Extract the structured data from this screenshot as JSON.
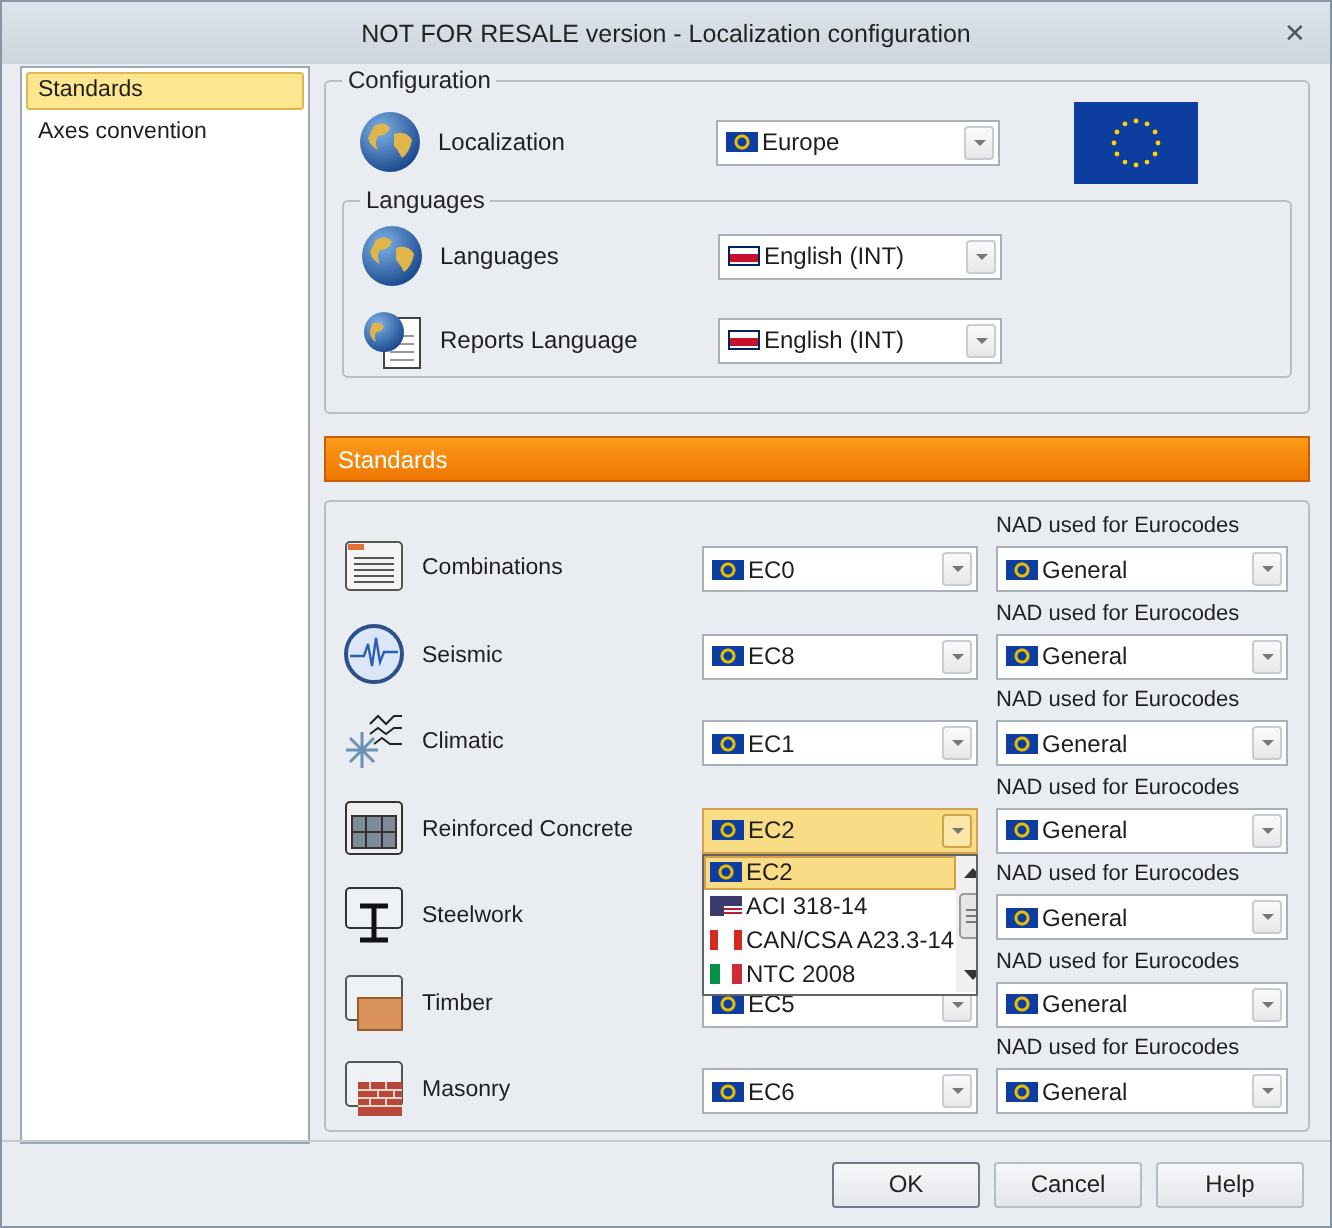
{
  "window": {
    "title": "NOT FOR RESALE version - Localization configuration",
    "close": "✕"
  },
  "sidebar": {
    "items": [
      {
        "label": "Standards",
        "selected": true
      },
      {
        "label": "Axes convention",
        "selected": false
      }
    ]
  },
  "configuration": {
    "title": "Configuration",
    "localization": {
      "label": "Localization",
      "value": "Europe"
    },
    "languages_group": {
      "title": "Languages",
      "rows": [
        {
          "label": "Languages",
          "value": "English (INT)"
        },
        {
          "label": "Reports Language",
          "value": "English (INT)"
        }
      ]
    }
  },
  "standards": {
    "header": "Standards",
    "rows": [
      {
        "name": "Combinations",
        "value": "EC0",
        "focused": false,
        "nad_label": "NAD used for Eurocodes",
        "nad_value": "General"
      },
      {
        "name": "Seismic",
        "value": "EC8",
        "focused": false,
        "nad_label": "NAD used for Eurocodes",
        "nad_value": "General"
      },
      {
        "name": "Climatic",
        "value": "EC1",
        "focused": false,
        "nad_label": "NAD used for Eurocodes",
        "nad_value": "General"
      },
      {
        "name": "Reinforced Concrete",
        "value": "EC2",
        "focused": true,
        "nad_label": "NAD used for Eurocodes",
        "nad_value": "General",
        "options": [
          {
            "label": "EC2",
            "selected": true
          },
          {
            "label": "ACI 318-14",
            "selected": false
          },
          {
            "label": "CAN/CSA A23.3-14",
            "selected": false
          },
          {
            "label": "NTC 2008",
            "selected": false
          }
        ]
      },
      {
        "name": "Steelwork",
        "nad_label": "NAD used for Eurocodes",
        "nad_value": "General"
      },
      {
        "name": "Timber",
        "value": "EC5",
        "focused": false,
        "nad_label": "NAD used for Eurocodes",
        "nad_value": "General"
      },
      {
        "name": "Masonry",
        "value": "EC6",
        "focused": false,
        "nad_label": "NAD used for Eurocodes",
        "nad_value": "General"
      }
    ]
  },
  "buttons": [
    {
      "label": "OK",
      "default": true
    },
    {
      "label": "Cancel",
      "default": false
    },
    {
      "label": "Help",
      "default": false
    }
  ]
}
